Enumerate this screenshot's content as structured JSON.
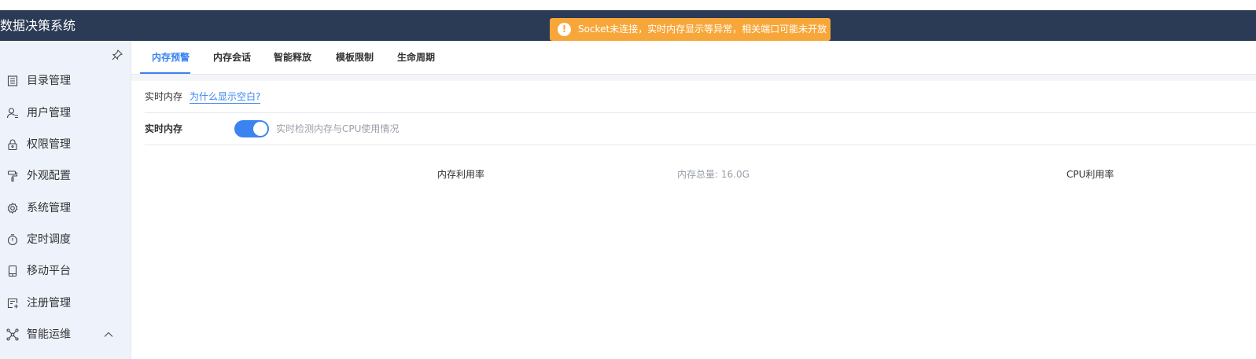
{
  "header": {
    "app_title": "数据决策系统",
    "toast": {
      "icon": "exclamation-icon",
      "message": "Socket未连接，实时内存显示等异常，相关端口可能未开放",
      "color": "#f7a73a"
    }
  },
  "sidebar": {
    "pin_icon": "pin-icon",
    "items": [
      {
        "label": "目录管理",
        "icon": "catalog-icon"
      },
      {
        "label": "用户管理",
        "icon": "user-icon"
      },
      {
        "label": "权限管理",
        "icon": "lock-icon"
      },
      {
        "label": "外观配置",
        "icon": "paint-roller-icon"
      },
      {
        "label": "系统管理",
        "icon": "gear-icon"
      },
      {
        "label": "定时调度",
        "icon": "stopwatch-icon"
      },
      {
        "label": "移动平台",
        "icon": "mobile-icon"
      },
      {
        "label": "注册管理",
        "icon": "register-icon"
      },
      {
        "label": "智能运维",
        "icon": "network-icon",
        "expanded": true
      }
    ]
  },
  "tabs": [
    {
      "label": "内存预警",
      "active": true
    },
    {
      "label": "内存会话"
    },
    {
      "label": "智能释放"
    },
    {
      "label": "模板限制"
    },
    {
      "label": "生命周期"
    }
  ],
  "content": {
    "section_label": "实时内存",
    "help_link": "为什么显示空白?",
    "toggle_label": "实时内存",
    "toggle_on": true,
    "toggle_desc": "实时检测内存与CPU使用情况",
    "memory_chart_title": "内存利用率",
    "memory_total": "内存总量: 16.0G",
    "cpu_chart_title": "CPU利用率"
  },
  "colors": {
    "header_bg": "#2b3b55",
    "accent": "#3b83f0",
    "sidebar_bg": "#eef3fb"
  }
}
